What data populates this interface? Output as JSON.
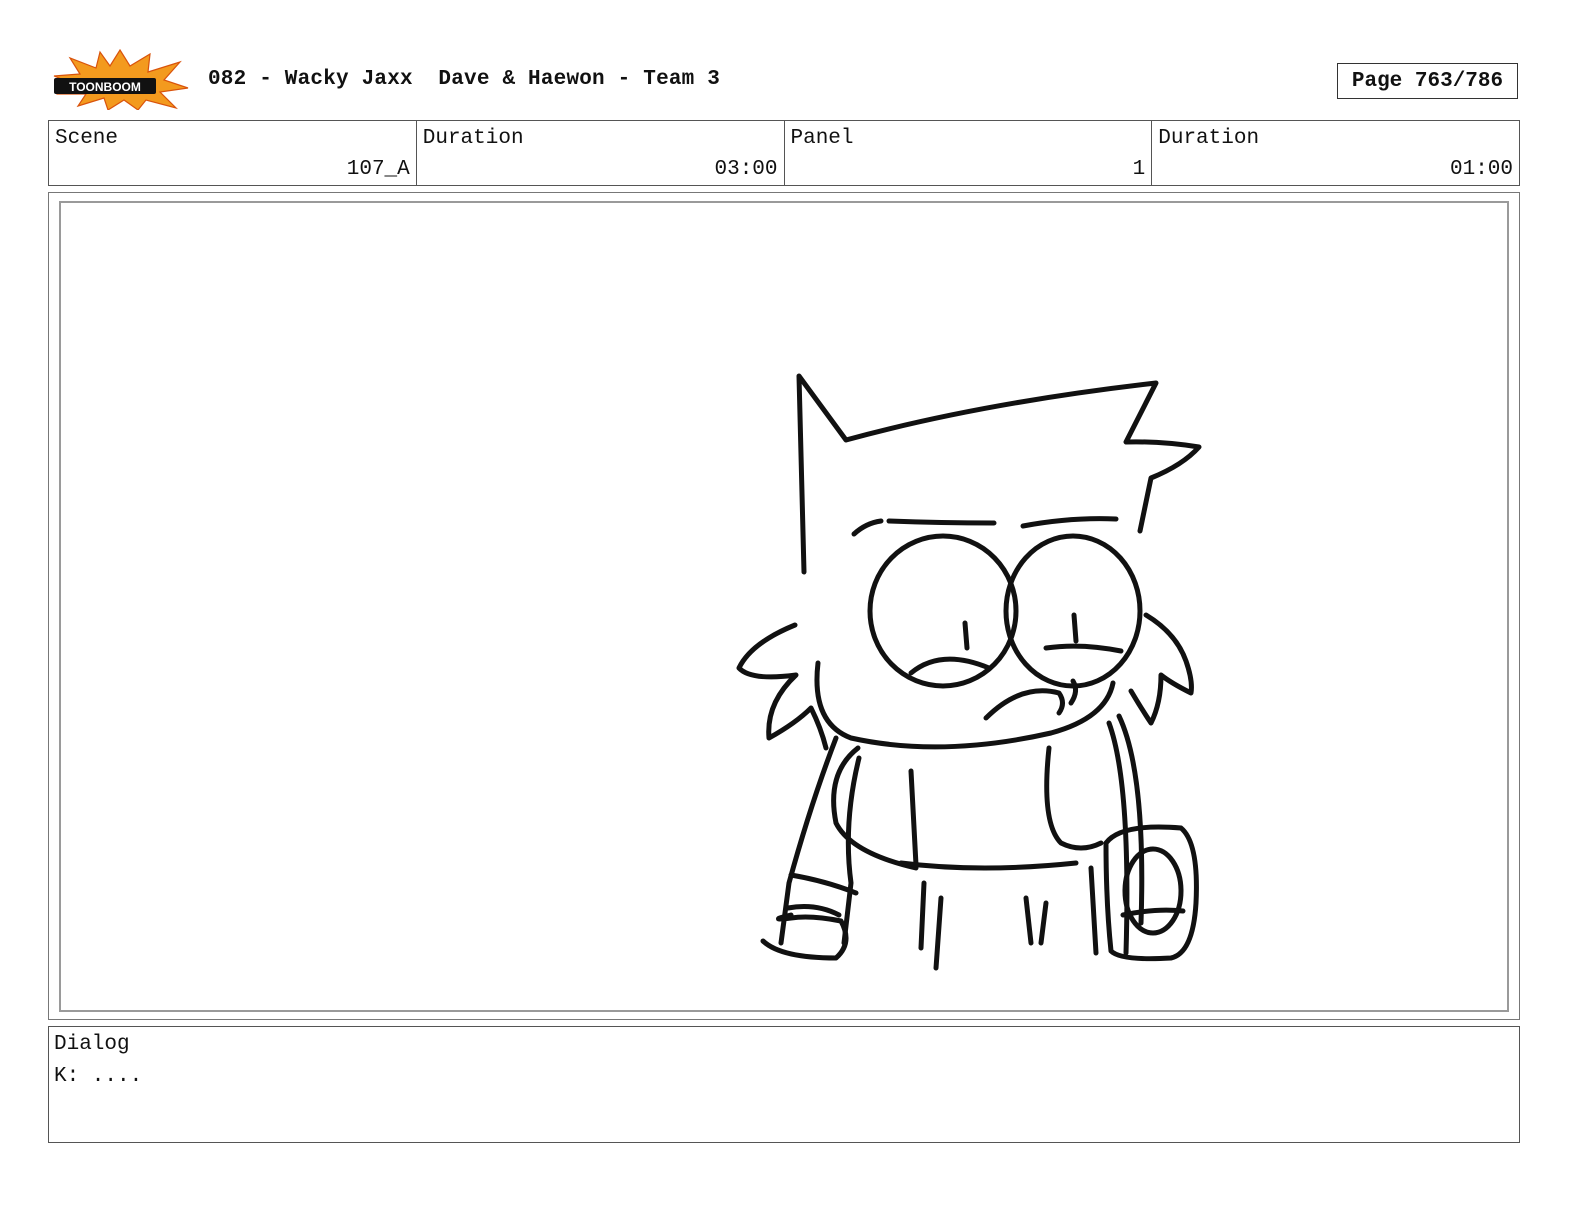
{
  "header": {
    "logo_text": "TOONBOOM",
    "title": "082 - Wacky Jaxx  Dave & Haewon - Team 3",
    "page": "Page 763/786"
  },
  "info": {
    "scene_label": "Scene",
    "scene_value": "107_A",
    "scene_duration_label": "Duration",
    "scene_duration_value": "03:00",
    "panel_label": "Panel",
    "panel_value": "1",
    "panel_duration_label": "Duration",
    "panel_duration_value": "01:00"
  },
  "dialog": {
    "label": "Dialog",
    "text": "K: ...."
  },
  "colors": {
    "logo_burst": "#f39a1e",
    "logo_burst_dark": "#d9530c",
    "line": "#111111"
  }
}
